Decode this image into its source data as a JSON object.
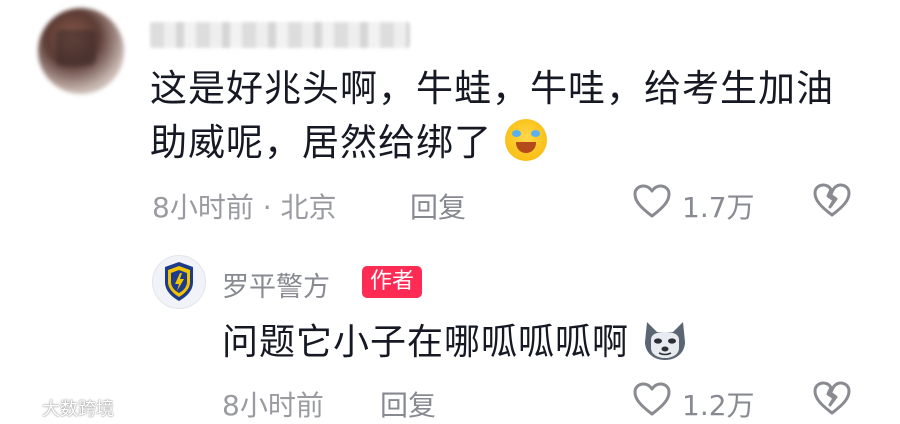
{
  "comment": {
    "text": "这是好兆头啊，牛蛙，牛哇，给考生加油助威呢，居然给绑了",
    "emoji": "laughing-tears-emoji",
    "meta": "8小时前 · 北京",
    "reply_label": "回复",
    "likes": "1.7万"
  },
  "reply": {
    "author": "罗平警方",
    "badge": "作者",
    "text": "问题它小子在哪呱呱呱啊",
    "emoji": "husky-emoji",
    "meta": "8小时前",
    "reply_label": "回复",
    "likes": "1.2万"
  },
  "watermark": {
    "text": "大数跨境"
  },
  "colors": {
    "accent": "#fe2c55",
    "meta": "#9a9ba1",
    "text": "#161823"
  }
}
